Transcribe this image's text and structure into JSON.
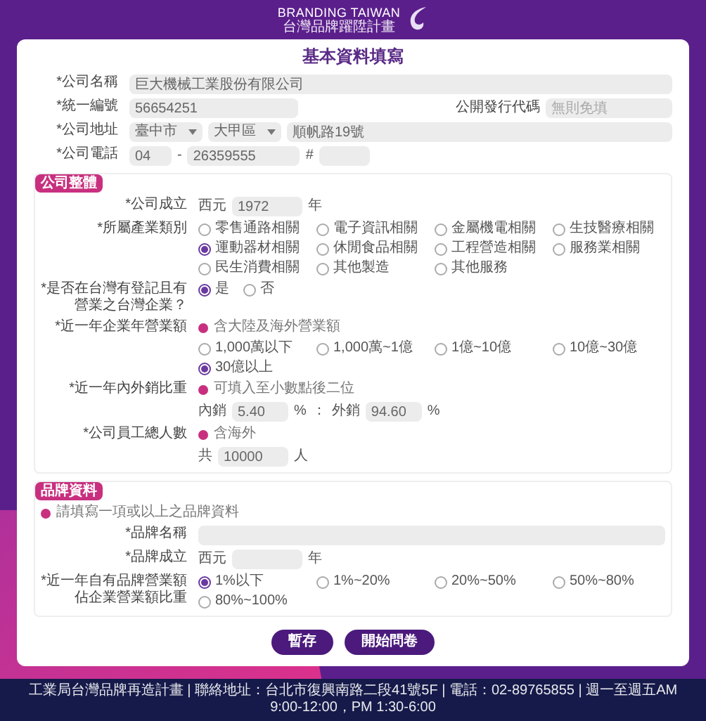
{
  "header": {
    "brand_en": "BRANDING TAIWAN",
    "brand_zh": "台灣品牌躍陞計畫"
  },
  "form": {
    "title": "基本資料填寫",
    "basic_rows": [
      {
        "kind": "text",
        "label": "*公司名稱",
        "value": "巨大機械工業股份有限公司"
      },
      {
        "kind": "pair",
        "label": "*統一編號",
        "value": "56654251",
        "label2": "公開發行代碼",
        "placeholder2": "無則免填"
      },
      {
        "kind": "address",
        "label": "*公司地址",
        "city": "臺中市",
        "district": "大甲區",
        "street": "順帆路19號"
      },
      {
        "kind": "phone",
        "label": "*公司電話",
        "area": "04",
        "separator": "-",
        "number": "26359555",
        "ext_mark": "#"
      }
    ],
    "sections": [
      {
        "title": "公司整體",
        "rows": [
          {
            "kind": "year",
            "label": "*公司成立",
            "prefix": "西元",
            "value": "1972",
            "suffix": "年"
          },
          {
            "kind": "radio",
            "label": "*所屬產業類別",
            "options": [
              {
                "label": "零售通路相關",
                "selected": false
              },
              {
                "label": "電子資訊相關",
                "selected": false
              },
              {
                "label": "金屬機電相關",
                "selected": false
              },
              {
                "label": "生技醫療相關",
                "selected": false
              },
              {
                "label": "運動器材相關",
                "selected": true
              },
              {
                "label": "休閒食品相關",
                "selected": false
              },
              {
                "label": "工程營造相關",
                "selected": false
              },
              {
                "label": "服務業相關",
                "selected": false
              },
              {
                "label": "民生消費相關",
                "selected": false
              },
              {
                "label": "其他製造",
                "selected": false
              },
              {
                "label": "其他服務",
                "selected": false
              }
            ]
          },
          {
            "kind": "radio",
            "label": "*是否在台灣有登記且有營業之台灣企業？",
            "options": [
              {
                "label": "是",
                "selected": true
              },
              {
                "label": "否",
                "selected": false
              }
            ]
          },
          {
            "kind": "radio",
            "label": "*近一年企業年營業額",
            "note": "含大陸及海外營業額",
            "options": [
              {
                "label": "1,000萬以下",
                "selected": false
              },
              {
                "label": "1,000萬~1億",
                "selected": false
              },
              {
                "label": "1億~10億",
                "selected": false
              },
              {
                "label": "10億~30億",
                "selected": false
              },
              {
                "label": "30億以上",
                "selected": true
              }
            ]
          },
          {
            "kind": "ratio",
            "label": "*近一年內外銷比重",
            "note": "可填入至小數點後二位",
            "domestic_label": "內銷",
            "domestic": "5.40",
            "unit": "%",
            "sep": "：",
            "export_label": "外銷",
            "export": "94.60"
          },
          {
            "kind": "count",
            "label": "*公司員工總人數",
            "note": "含海外",
            "prefix": "共",
            "value": "10000",
            "suffix": "人"
          }
        ]
      },
      {
        "title": "品牌資料",
        "note": "請填寫一項或以上之品牌資料",
        "rows": [
          {
            "kind": "text",
            "label": "*品牌名稱",
            "value": ""
          },
          {
            "kind": "year",
            "label": "*品牌成立",
            "prefix": "西元",
            "value": "",
            "suffix": "年"
          },
          {
            "kind": "radio",
            "label": "*近一年自有品牌營業額佔企業營業額比重",
            "options": [
              {
                "label": "1%以下",
                "selected": true
              },
              {
                "label": "1%~20%",
                "selected": false
              },
              {
                "label": "20%~50%",
                "selected": false
              },
              {
                "label": "50%~80%",
                "selected": false
              },
              {
                "label": "80%~100%",
                "selected": false
              }
            ]
          }
        ]
      }
    ],
    "buttons": [
      {
        "label": "暫存"
      },
      {
        "label": "開始問卷"
      }
    ]
  },
  "footer": "工業局台灣品牌再造計畫 | 聯絡地址：台北市復興南路二段41號5F | 電話：02-89765855 | 週一至週五AM 9:00-12:00，PM 1:30-6:00"
}
